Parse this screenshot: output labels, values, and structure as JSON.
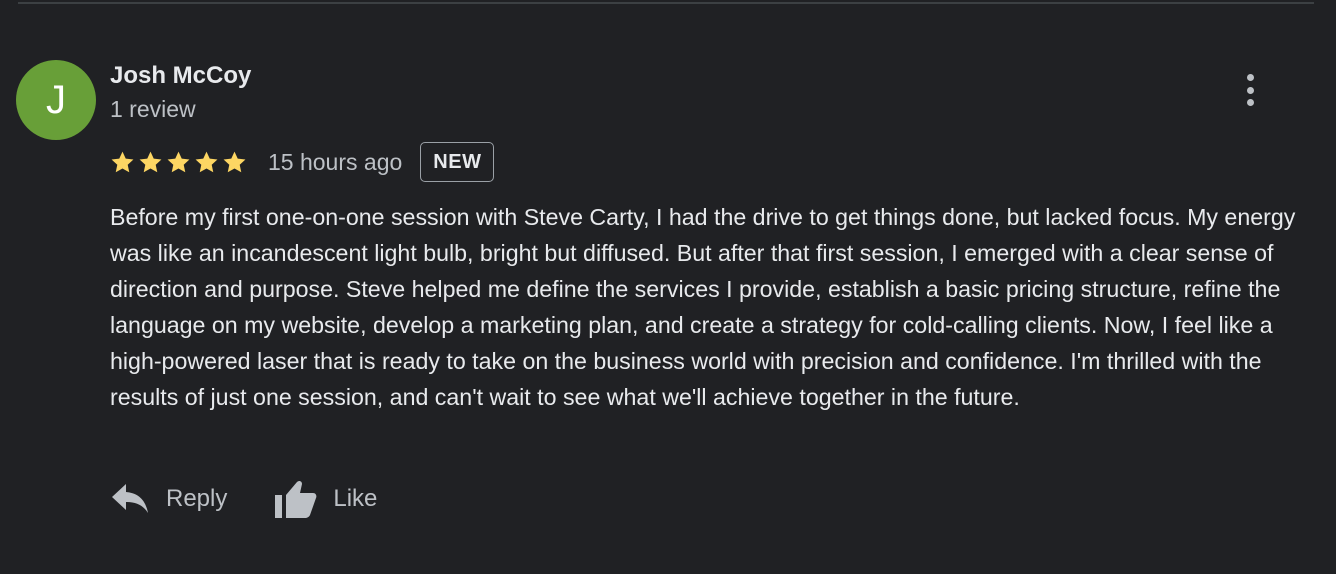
{
  "review": {
    "avatar_initial": "J",
    "author_name": "Josh McCoy",
    "review_count": "1 review",
    "rating": 5,
    "rating_max": 5,
    "time_ago": "15 hours ago",
    "badge": "NEW",
    "text": "Before my first one-on-one session with Steve Carty, I had the drive to get things done, but lacked focus. My energy was like an incandescent light bulb, bright but diffused. But after that first session, I emerged with a clear sense of direction and purpose. Steve helped me define the services I provide, establish a basic pricing structure, refine the language on my website, develop a marketing plan, and create a strategy for cold-calling clients. Now, I feel like a high-powered laser that is ready to take on the business world with precision and confidence. I'm thrilled with the results of just one session, and can't wait to see what we'll achieve together in the future."
  },
  "actions": {
    "reply_label": "Reply",
    "like_label": "Like"
  },
  "icons": {
    "more": "more-vert-icon",
    "star": "star-icon",
    "reply": "reply-icon",
    "like": "thumb-up-icon"
  },
  "colors": {
    "background": "#202124",
    "star": "#fdd663",
    "avatar": "#689f38",
    "primary_text": "#e8eaed",
    "secondary_text": "#bdc1c6"
  }
}
